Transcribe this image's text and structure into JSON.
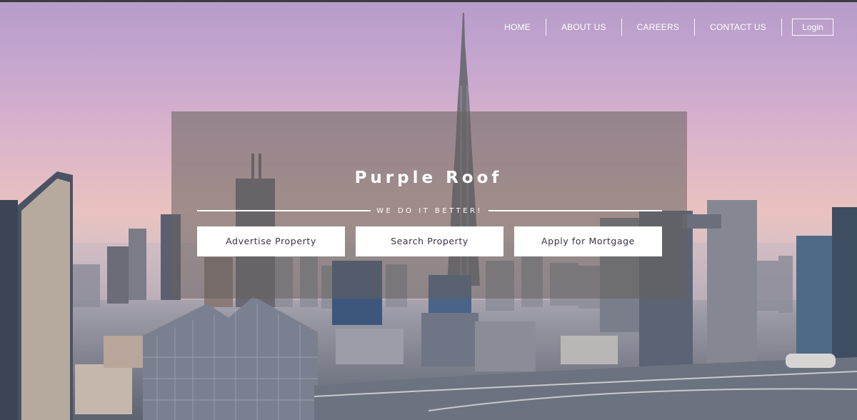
{
  "nav": {
    "items": [
      {
        "label": "HOME"
      },
      {
        "label": "ABOUT US"
      },
      {
        "label": "CAREERS"
      },
      {
        "label": "CONTACT US"
      }
    ],
    "login_label": "Login"
  },
  "hero": {
    "title": "Purple Roof",
    "tagline": "WE DO IT BETTER!",
    "actions": [
      {
        "label": "Advertise Property"
      },
      {
        "label": "Search Property"
      },
      {
        "label": "Apply for Mortgage"
      }
    ]
  },
  "colors": {
    "sky_top": "#b49cc9",
    "sky_horizon": "#e9c2bf",
    "button_text": "#3b3048",
    "panel_overlay": "rgba(100,96,92,0.55)"
  }
}
